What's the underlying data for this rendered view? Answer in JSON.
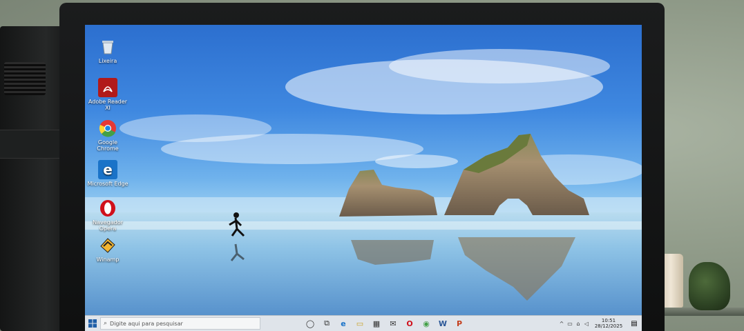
{
  "desktop": {
    "icons": [
      {
        "label": "Lixeira",
        "icon": "recycle-bin-icon"
      },
      {
        "label": "Adobe Reader XI",
        "icon": "adobe-reader-icon"
      },
      {
        "label": "Google Chrome",
        "icon": "chrome-icon"
      },
      {
        "label": "Microsoft Edge",
        "icon": "edge-icon"
      },
      {
        "label": "Navegador Opera",
        "icon": "opera-icon"
      },
      {
        "label": "Winamp",
        "icon": "winamp-icon"
      }
    ]
  },
  "taskbar": {
    "search_placeholder": "Digite aqui para pesquisar",
    "pinned": [
      {
        "name": "cortana-icon",
        "glyph": "◯"
      },
      {
        "name": "task-view-icon",
        "glyph": "⧉"
      },
      {
        "name": "edge-icon",
        "glyph": "e"
      },
      {
        "name": "file-explorer-icon",
        "glyph": "▭"
      },
      {
        "name": "store-icon",
        "glyph": "▦"
      },
      {
        "name": "mail-icon",
        "glyph": "✉"
      },
      {
        "name": "opera-icon",
        "glyph": "O"
      },
      {
        "name": "chrome-icon",
        "glyph": "◉"
      },
      {
        "name": "word-icon",
        "glyph": "W"
      },
      {
        "name": "powerpoint-icon",
        "glyph": "P"
      }
    ],
    "tray": {
      "chevron": "^",
      "time": "10:51",
      "date": "28/12/2025"
    }
  },
  "colors": {
    "taskbar_bg": "#dfe4ea",
    "sky_top": "#2c6fcf",
    "sea": "#4f8fcc"
  }
}
